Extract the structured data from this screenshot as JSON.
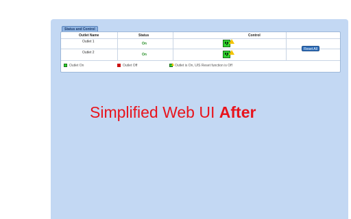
{
  "tab_label": "Status and Control",
  "table": {
    "headers": [
      "Outlet Name",
      "Status",
      "Control"
    ],
    "rows": [
      {
        "name": "Outlet 1",
        "status": "On"
      },
      {
        "name": "Outlet 2",
        "status": "On"
      }
    ],
    "reset_label": "Reset All"
  },
  "legend": {
    "on": "Outlet On",
    "off": "Outlet Off",
    "ups": "Outlet is On, UIS Reset function is Off"
  },
  "headline": {
    "text": "Simplified Web UI ",
    "emphasis": "After"
  },
  "colors": {
    "panel": "#c3d8f3",
    "on_green": "#2fd42f",
    "off_red": "#cc1111",
    "headline_red": "#e8141c"
  },
  "icons": {
    "outlet_on": "outlet-on-icon",
    "warning": "warning-icon"
  }
}
